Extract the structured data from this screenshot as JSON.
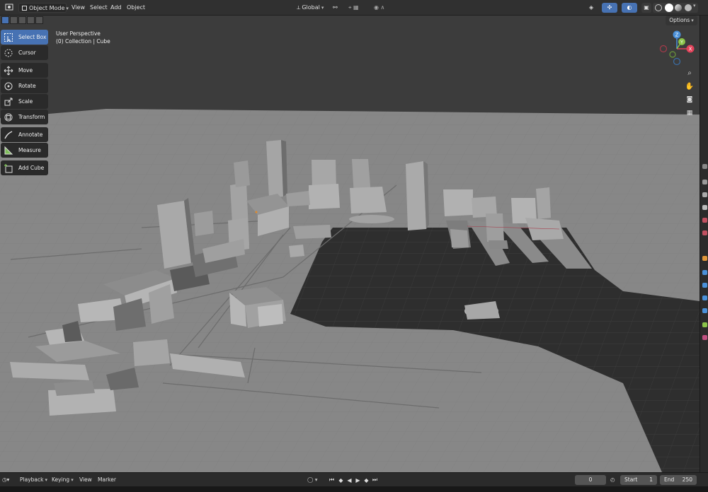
{
  "header": {
    "mode": "Object Mode",
    "menus": [
      "View",
      "Select",
      "Add",
      "Object"
    ],
    "transform_orientation": "Global",
    "options_label": "Options"
  },
  "viewport": {
    "perspective": "User Perspective",
    "collection": "(0) Collection | Cube"
  },
  "tools": [
    {
      "label": "Select Box",
      "icon": "select-box-icon",
      "active": true
    },
    {
      "label": "Cursor",
      "icon": "cursor-icon"
    },
    {
      "label": "Move",
      "icon": "move-icon"
    },
    {
      "label": "Rotate",
      "icon": "rotate-icon"
    },
    {
      "label": "Scale",
      "icon": "scale-icon"
    },
    {
      "label": "Transform",
      "icon": "transform-icon"
    },
    {
      "label": "Annotate",
      "icon": "annotate-icon"
    },
    {
      "label": "Measure",
      "icon": "measure-icon"
    },
    {
      "label": "Add Cube",
      "icon": "add-cube-icon"
    }
  ],
  "gizmo": {
    "z": "Z",
    "y": "Y",
    "x": "X"
  },
  "timeline": {
    "menus": [
      "Playback",
      "Keying",
      "View",
      "Marker"
    ],
    "current_frame": "0",
    "start_label": "Start",
    "start": "1",
    "end_label": "End",
    "end": "250"
  },
  "colors": {
    "accent": "#4772b3",
    "x_axis": "#e2425a",
    "y_axis": "#8bc34a",
    "z_axis": "#4a90d9"
  }
}
